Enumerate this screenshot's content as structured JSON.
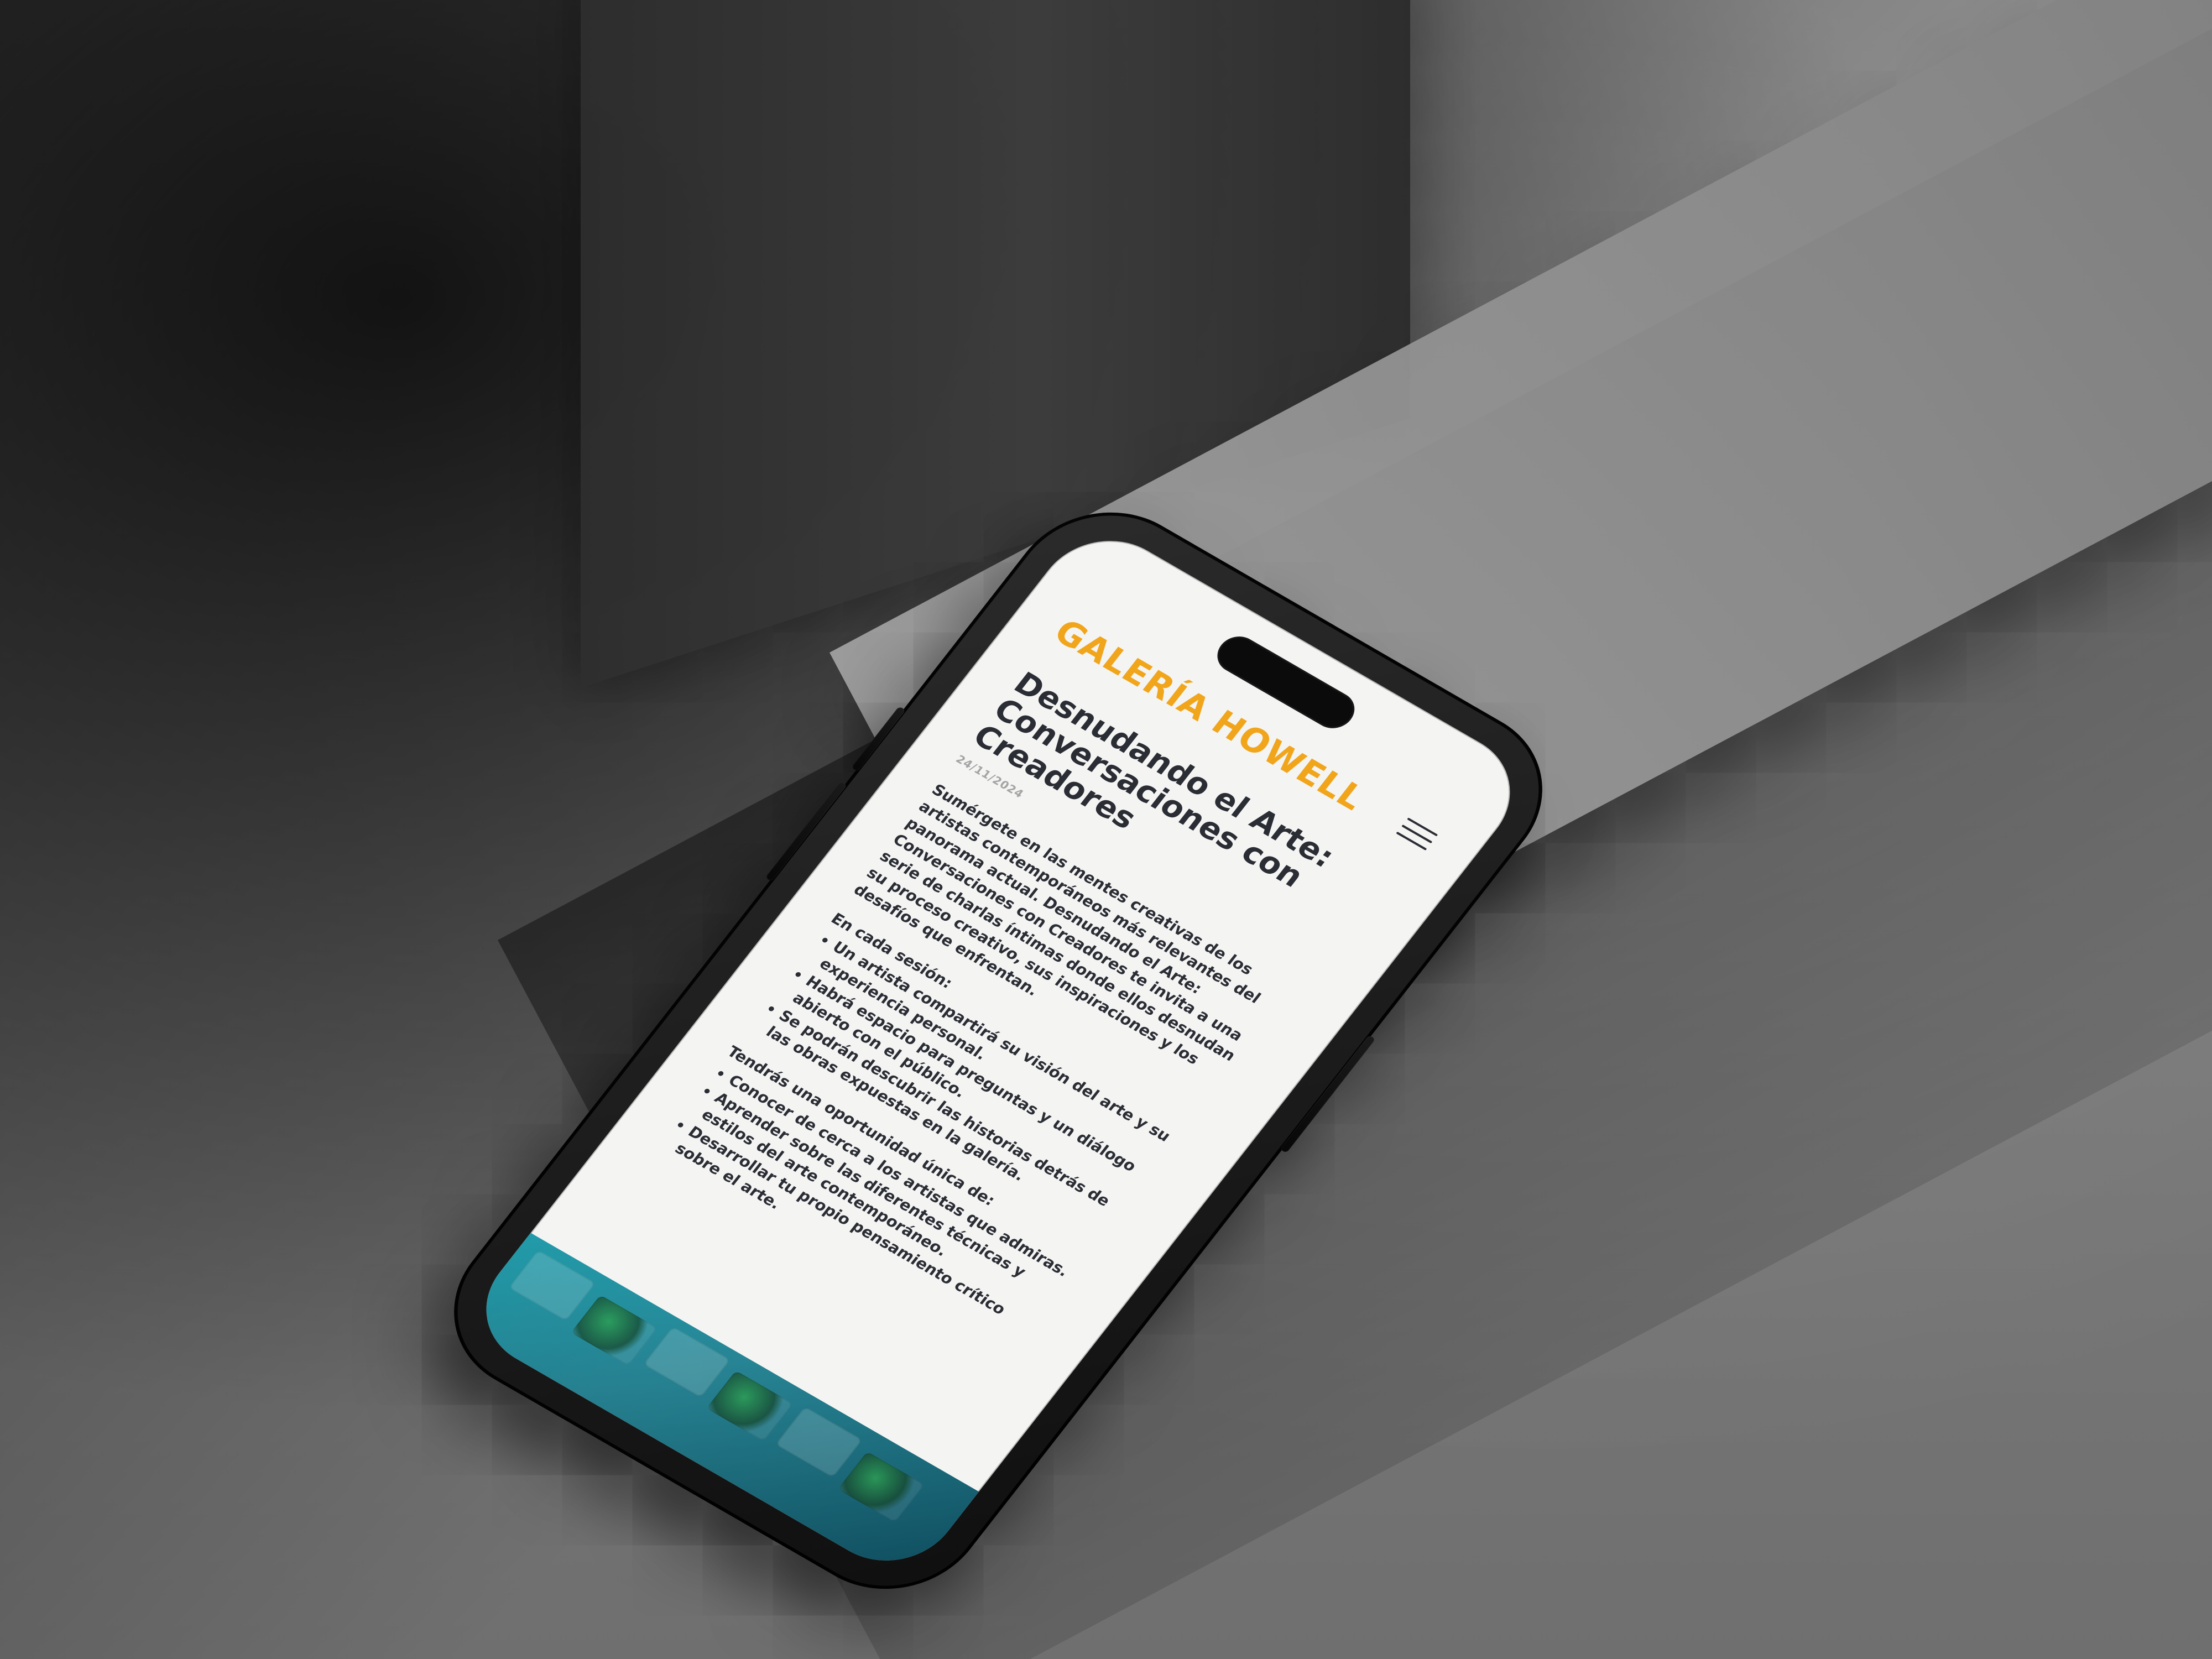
{
  "site": {
    "brand": "GALERÍA HOWELL"
  },
  "article": {
    "title": "Desnudando el Arte: Conversaciones con Creadores",
    "date": "24/11/2024",
    "intro": "Sumérgete en las mentes creativas de los artistas contemporáneos más relevantes del panorama actual. Desnudando el Arte: Conversaciones con Creadores te invita a una serie de charlas íntimas donde ellos desnudan su proceso creativo, sus inspiraciones y los desafíos que enfrentan.",
    "session_label": "En cada sesión:",
    "session_points": [
      "Un artista compartirá su visión del arte y su experiencia personal.",
      "Habrá espacio para preguntas y un diálogo abierto con el público.",
      "Se podrán descubrir las historias detrás de las obras expuestas en la galería."
    ],
    "opportunity_label": "Tendrás una oportunidad única de:",
    "opportunity_points": [
      "Conocer de cerca a los artistas que admiras.",
      "Aprender sobre las diferentes técnicas y estilos del arte contemporáneo.",
      "Desarrollar tu propio pensamiento crítico sobre el arte."
    ]
  },
  "ui": {
    "menu_icon": "hamburger-icon",
    "accent_color": "#f1a51b"
  }
}
